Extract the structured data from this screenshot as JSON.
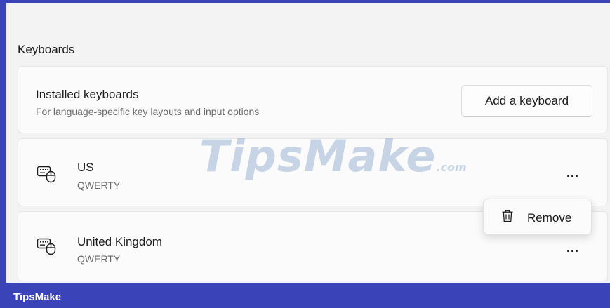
{
  "section": {
    "title": "Keyboards"
  },
  "installed": {
    "title": "Installed keyboards",
    "subtitle": "For language-specific key layouts and input options",
    "add_button_label": "Add a keyboard"
  },
  "keyboards": [
    {
      "name": "US",
      "layout": "QWERTY",
      "icon": "keyboard-icon",
      "more_label": "..."
    },
    {
      "name": "United Kingdom",
      "layout": "QWERTY",
      "icon": "keyboard-icon",
      "more_label": "..."
    }
  ],
  "context_menu": {
    "items": [
      {
        "label": "Remove",
        "icon": "trash-icon"
      }
    ]
  },
  "watermark": {
    "text": "TipsMake",
    "suffix": ".com"
  },
  "footer": {
    "brand": "TipsMake"
  },
  "colors": {
    "frame_border": "#3a43b8",
    "background": "#f3f3f3",
    "card": "#fbfbfb"
  }
}
